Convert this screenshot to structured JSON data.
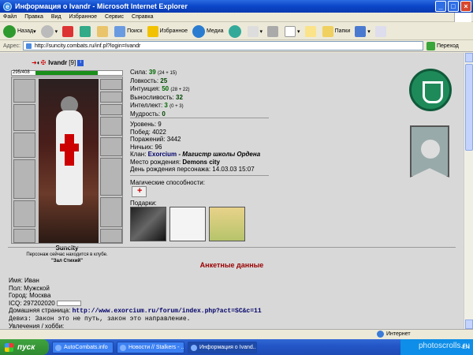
{
  "window": {
    "title": "Информация о Ivandr - Microsoft Internet Explorer"
  },
  "menu": [
    "Файл",
    "Правка",
    "Вид",
    "Избранное",
    "Сервис",
    "Справка"
  ],
  "toolbar": {
    "back": "Назад",
    "search": "Поиск",
    "favorites": "Избранное",
    "media": "Медиа",
    "folders": "Папки"
  },
  "address": {
    "label": "Адрес:",
    "url": "http://suncity.combats.ru/inf.pl?login=Ivandr",
    "go": "Переход"
  },
  "character": {
    "name": "Ivandr",
    "level": "[9]",
    "hp": "295/408",
    "hp_fraction": 0.72,
    "city": "Suncity",
    "location_note": "Персонаж сейчас находится в клубе.",
    "room": "\"Зал Стихий\""
  },
  "stats": [
    {
      "label": "Сила:",
      "value": "39",
      "extra": "(24 + 15)"
    },
    {
      "label": "Ловкость:",
      "value": "25",
      "extra": ""
    },
    {
      "label": "Интуиция:",
      "value": "50",
      "extra": "(28 + 22)"
    },
    {
      "label": "Выносливость:",
      "value": "32",
      "extra": ""
    },
    {
      "label": "Интеллект:",
      "value": "3",
      "extra": "(0 + 3)"
    },
    {
      "label": "Мудрость:",
      "value": "0",
      "extra": ""
    }
  ],
  "info": {
    "level": "Уровень: 9",
    "wins": "Побед: 4022",
    "losses": "Поражений: 3442",
    "draws": "Ничьих: 96",
    "clan_label": "Клан:",
    "clan_name": "Exorcium",
    "clan_rank": "- Магистр школы Ордена",
    "birthplace_label": "Место рождения:",
    "birthplace": "Demons city",
    "birthday": "День рождения персонажа: 14.03.03 15:07"
  },
  "magic_label": "Магические способности:",
  "gifts_label": "Подарки:",
  "profile": {
    "title": "Анкетные данные",
    "name": "Имя: Иван",
    "gender": "Пол: Мужской",
    "city": "Город: Москва",
    "icq": "ICQ: 297202020",
    "homepage_label": "Домашняя страница:",
    "homepage": "http://www.exorcium.ru/forum/index.php?act=SC&c=11",
    "motto": "Девиз: Закон это не путь, закон это направление.",
    "hobby": "Увлечения / хобби:"
  },
  "status": {
    "zone": "Интернет"
  },
  "taskbar": {
    "start": "пуск",
    "items": [
      "AutoCombats.info",
      "Новости // Stalkers - ...",
      "Информация о Ivand..."
    ],
    "tray": "EN"
  },
  "watermark": "photoscrolls.ru",
  "colors": {
    "accent": "#0a46c8",
    "profile_title": "#9a0000",
    "clan": "#00006a"
  }
}
